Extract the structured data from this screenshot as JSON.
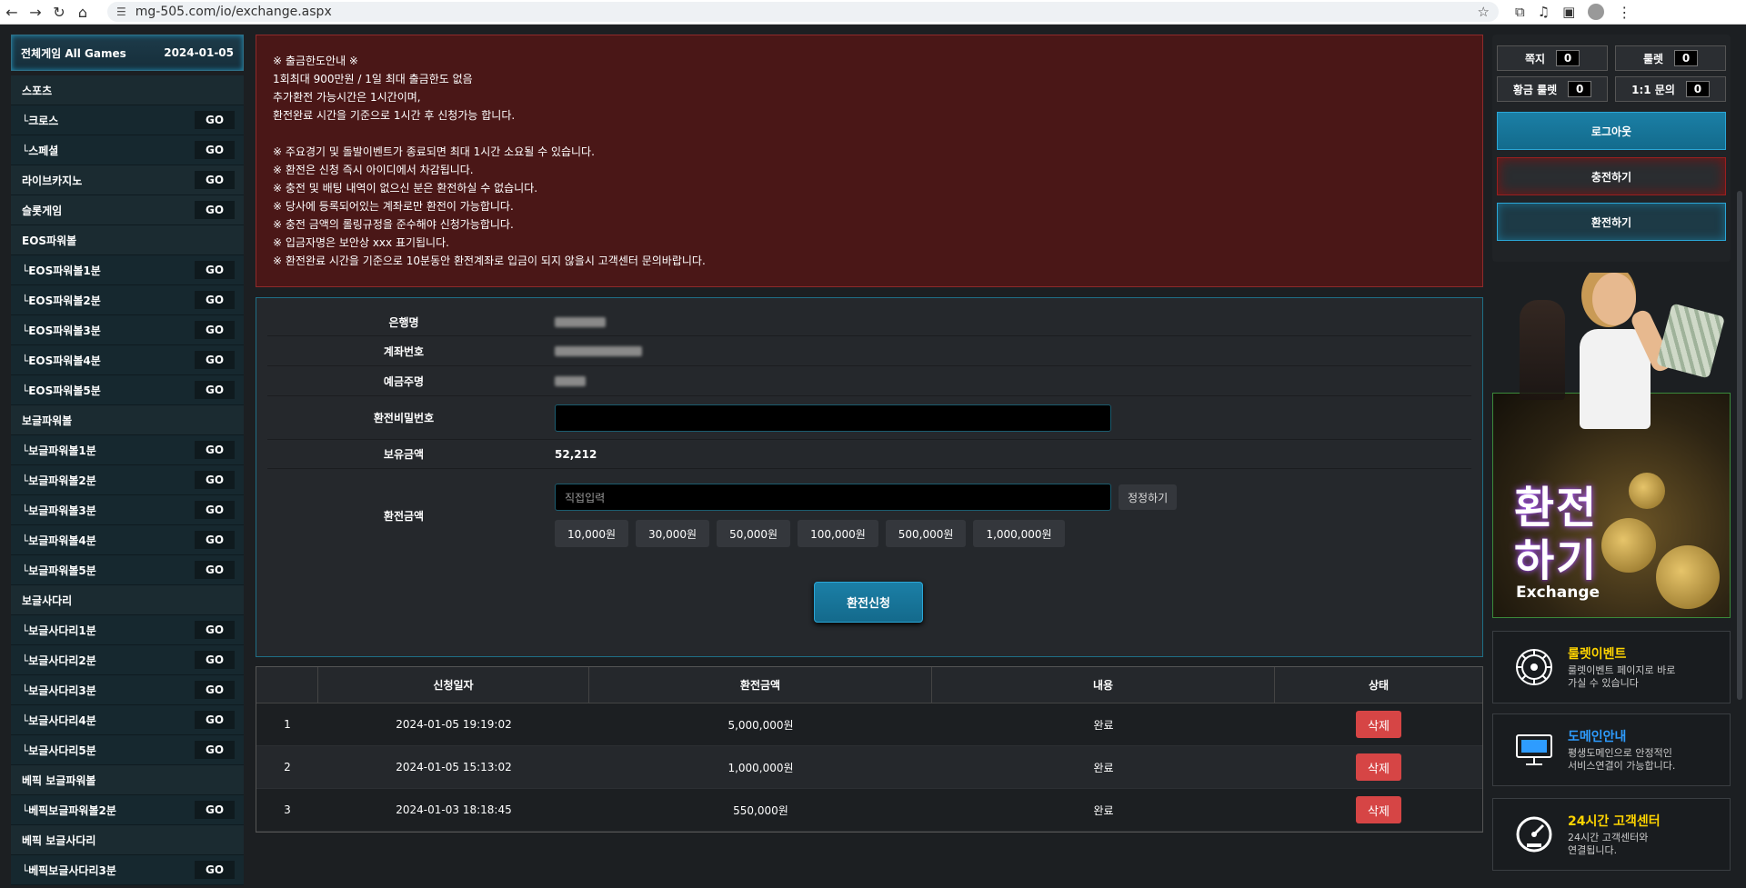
{
  "browser": {
    "url": "mg-505.com/io/exchange.aspx"
  },
  "sidebar": {
    "title": "전체게임 All Games",
    "date": "2024-01-05",
    "go_label": "GO",
    "items": [
      {
        "label": "스포츠",
        "go": false,
        "cat": true
      },
      {
        "label": "└크로스",
        "go": true
      },
      {
        "label": "└스페셜",
        "go": true
      },
      {
        "label": "라이브카지노",
        "go": true,
        "cat": true
      },
      {
        "label": "슬롯게임",
        "go": true,
        "cat": true
      },
      {
        "label": "EOS파워볼",
        "go": false,
        "cat": true
      },
      {
        "label": "└EOS파워볼1분",
        "go": true
      },
      {
        "label": "└EOS파워볼2분",
        "go": true
      },
      {
        "label": "└EOS파워볼3분",
        "go": true
      },
      {
        "label": "└EOS파워볼4분",
        "go": true
      },
      {
        "label": "└EOS파워볼5분",
        "go": true
      },
      {
        "label": "보글파워볼",
        "go": false,
        "cat": true
      },
      {
        "label": "└보글파워볼1분",
        "go": true
      },
      {
        "label": "└보글파워볼2분",
        "go": true
      },
      {
        "label": "└보글파워볼3분",
        "go": true
      },
      {
        "label": "└보글파워볼4분",
        "go": true
      },
      {
        "label": "└보글파워볼5분",
        "go": true
      },
      {
        "label": "보글사다리",
        "go": false,
        "cat": true
      },
      {
        "label": "└보글사다리1분",
        "go": true
      },
      {
        "label": "└보글사다리2분",
        "go": true
      },
      {
        "label": "└보글사다리3분",
        "go": true
      },
      {
        "label": "└보글사다리4분",
        "go": true
      },
      {
        "label": "└보글사다리5분",
        "go": true
      },
      {
        "label": "베픽 보글파워볼",
        "go": false,
        "cat": true
      },
      {
        "label": "└베픽보글파워볼2분",
        "go": true
      },
      {
        "label": "베픽 보글사다리",
        "go": false,
        "cat": true
      },
      {
        "label": "└베픽보글사다리3분",
        "go": true
      }
    ]
  },
  "notice": {
    "group1": [
      "※ 출금한도안내 ※",
      "1회최대 900만원 / 1일 최대 출금한도 없음",
      "추가환전 가능시간은 1시간이며,",
      "환전완료 시간을 기준으로 1시간 후 신청가능 합니다."
    ],
    "group2": [
      "※ 주요경기 및 돌발이벤트가 종료되면 최대 1시간 소요될 수 있습니다.",
      "※ 환전은 신청 즉시 아이디에서 차감됩니다.",
      "※ 충전 및 배팅 내역이 없으신 분은 환전하실 수 없습니다.",
      "※ 당사에 등록되어있는 계좌로만 환전이 가능합니다.",
      "※ 충전 금액의 롤링규정을 준수해야 신청가능합니다.",
      "※ 입금자명은 보안상 xxx 표기됩니다.",
      "※ 환전완료 시간을 기준으로 10분동안 환전계좌로 입금이 되지 않을시 고객센터 문의바랍니다."
    ]
  },
  "form": {
    "bank_label": "은행명",
    "account_label": "계좌번호",
    "holder_label": "예금주명",
    "password_label": "환전비밀번호",
    "balance_label": "보유금액",
    "balance_value": "52,212",
    "amount_label": "환전금액",
    "amount_placeholder": "직접입력",
    "reset_label": "정정하기",
    "presets": [
      "10,000원",
      "30,000원",
      "50,000원",
      "100,000원",
      "500,000원",
      "1,000,000원"
    ],
    "submit_label": "환전신청"
  },
  "history": {
    "headers": [
      "",
      "신청일자",
      "환전금액",
      "내용",
      "상태"
    ],
    "rows": [
      {
        "no": "1",
        "date": "2024-01-05 19:19:02",
        "amount": "5,000,000원",
        "content": "완료",
        "action": "삭제"
      },
      {
        "no": "2",
        "date": "2024-01-05 15:13:02",
        "amount": "1,000,000원",
        "content": "완료",
        "action": "삭제"
      },
      {
        "no": "3",
        "date": "2024-01-03 18:18:45",
        "amount": "550,000원",
        "content": "완료",
        "action": "삭제"
      }
    ]
  },
  "account_panel": {
    "messages_label": "쪽지",
    "messages_count": "0",
    "roulette_label": "룰렛",
    "roulette_count": "0",
    "gold_roulette_label": "황금 룰렛",
    "gold_roulette_count": "0",
    "inquiry_label": "1:1 문의",
    "inquiry_count": "0",
    "logout_label": "로그아웃",
    "deposit_label": "충전하기",
    "withdraw_label": "환전하기"
  },
  "banner": {
    "title_line1": "환전",
    "title_line2": "하기",
    "subtitle": "Exchange"
  },
  "cards": [
    {
      "title": "룰렛이벤트",
      "desc1": "룰렛이벤트 페이지로 바로",
      "desc2": "가실 수 있습니다",
      "icon": "roulette-icon"
    },
    {
      "title": "도메인안내",
      "desc1": "평생도메인으로 안정적인",
      "desc2": "서비스연결이 가능합니다.",
      "icon": "monitor-icon"
    },
    {
      "title": "24시간 고객센터",
      "desc1": "24시간 고객센터와",
      "desc2": "연결됩니다.",
      "icon": "support-gauge-icon"
    }
  ],
  "colors": {
    "accent": "#1b7fa6",
    "notice_bg": "#4a1717",
    "delete": "#d64545",
    "card_yellow": "#ffd400"
  }
}
